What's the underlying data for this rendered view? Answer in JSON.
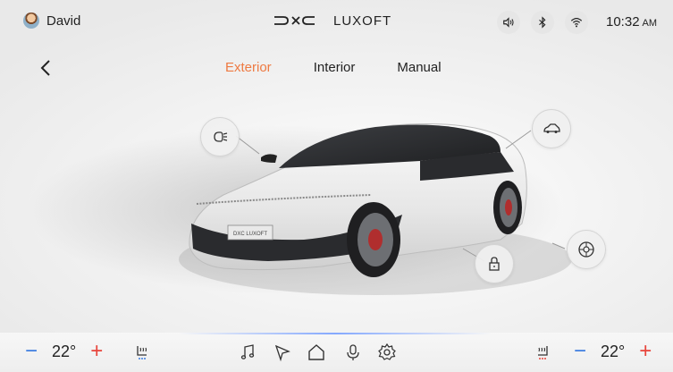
{
  "status_bar": {
    "user_name": "David",
    "brand_name": "LUXOFT",
    "time": "10:32",
    "ampm": "AM",
    "icons": [
      "volume-icon",
      "bluetooth-icon",
      "wifi-icon"
    ]
  },
  "tabs": [
    {
      "label": "Exterior",
      "active": true
    },
    {
      "label": "Interior",
      "active": false
    },
    {
      "label": "Manual",
      "active": false
    }
  ],
  "car": {
    "plate_text": "DXC LUXOFT",
    "hotspots": [
      "headlight-icon",
      "car-roof-icon",
      "door-lock-icon",
      "wheel-icon"
    ]
  },
  "climate": {
    "left_temp": "22°",
    "right_temp": "22°",
    "minus": "−",
    "plus": "+"
  },
  "dock": [
    "music-icon",
    "navigation-icon",
    "home-icon",
    "microphone-icon",
    "settings-icon"
  ],
  "colors": {
    "accent": "#ee7a42",
    "temp_down": "#3a7be0",
    "temp_up": "#e8443b"
  }
}
